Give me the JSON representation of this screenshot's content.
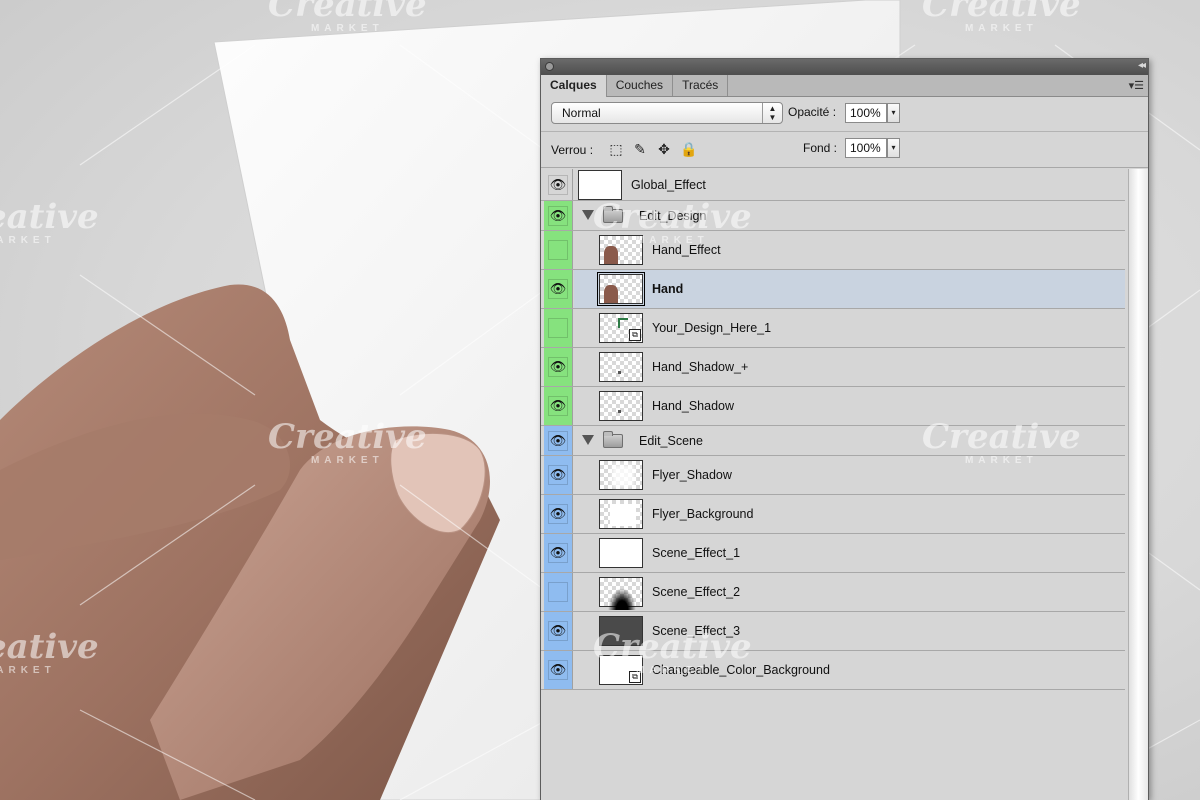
{
  "watermark": {
    "brand": "Creative",
    "sub": "MARKET"
  },
  "panel": {
    "tabs": [
      {
        "label": "Calques",
        "active": true
      },
      {
        "label": "Couches",
        "active": false
      },
      {
        "label": "Tracés",
        "active": false
      }
    ],
    "blend_mode": "Normal",
    "opacity_label": "Opacité :",
    "opacity_value": "100%",
    "lock_label": "Verrou :",
    "fill_label": "Fond :",
    "fill_value": "100%",
    "lock_icons": [
      "lock-transparency-icon",
      "lock-paint-icon",
      "lock-position-icon",
      "lock-all-icon"
    ]
  },
  "layers": [
    {
      "name": "Global_Effect",
      "type": "layer",
      "visible": true,
      "color": "none"
    },
    {
      "name": "Edit_Design",
      "type": "group",
      "visible": true,
      "color": "green"
    },
    {
      "name": "Hand_Effect",
      "type": "layer",
      "visible": false,
      "color": "green"
    },
    {
      "name": "Hand",
      "type": "layer",
      "visible": true,
      "color": "green",
      "selected": true
    },
    {
      "name": "Your_Design_Here_1",
      "type": "smart",
      "visible": false,
      "color": "green"
    },
    {
      "name": "Hand_Shadow_+",
      "type": "layer",
      "visible": true,
      "color": "green"
    },
    {
      "name": "Hand_Shadow",
      "type": "layer",
      "visible": true,
      "color": "green"
    },
    {
      "name": "Edit_Scene",
      "type": "group",
      "visible": true,
      "color": "blue"
    },
    {
      "name": "Flyer_Shadow",
      "type": "layer",
      "visible": true,
      "color": "blue"
    },
    {
      "name": "Flyer_Background",
      "type": "layer",
      "visible": true,
      "color": "blue"
    },
    {
      "name": "Scene_Effect_1",
      "type": "layer",
      "visible": true,
      "color": "blue"
    },
    {
      "name": "Scene_Effect_2",
      "type": "layer",
      "visible": false,
      "color": "blue"
    },
    {
      "name": "Scene_Effect_3",
      "type": "layer",
      "visible": true,
      "color": "blue"
    },
    {
      "name": "Changeable_Color_Background",
      "type": "smart",
      "visible": true,
      "color": "blue"
    }
  ]
}
